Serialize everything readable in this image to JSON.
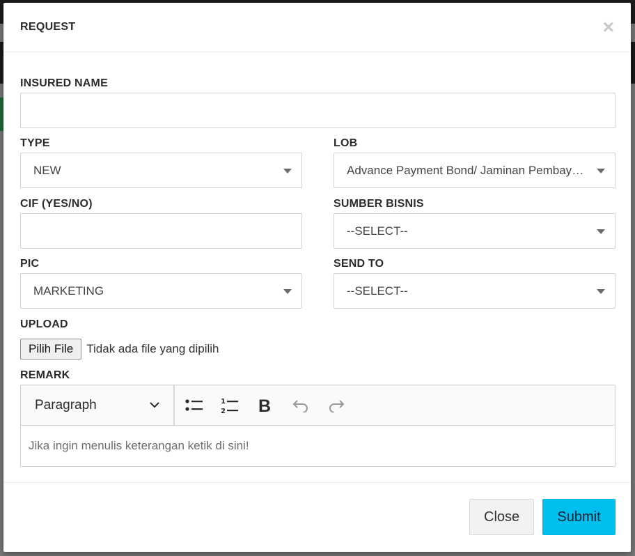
{
  "modal": {
    "title": "REQUEST",
    "close_icon": "close-icon"
  },
  "form": {
    "insured_name": {
      "label": "INSURED NAME",
      "value": ""
    },
    "type": {
      "label": "TYPE",
      "value": "NEW"
    },
    "lob": {
      "label": "LOB",
      "value": "Advance Payment Bond/ Jaminan Pembayaran Uang Muka"
    },
    "cif": {
      "label": "CIF (YES/NO)",
      "value": ""
    },
    "sumber_bisnis": {
      "label": "SUMBER BISNIS",
      "value": "--SELECT--"
    },
    "pic": {
      "label": "PIC",
      "value": "MARKETING"
    },
    "send_to": {
      "label": "SEND TO",
      "value": "--SELECT--"
    },
    "upload": {
      "label": "UPLOAD",
      "button": "Pilih File",
      "status": "Tidak ada file yang dipilih"
    },
    "remark": {
      "label": "REMARK",
      "block_format": "Paragraph",
      "placeholder": "Jika ingin menulis keterangan ketik di sini!",
      "toolbar_icons": [
        "bulleted-list-icon",
        "numbered-list-icon",
        "bold-icon",
        "undo-icon",
        "redo-icon"
      ]
    }
  },
  "footer": {
    "close_label": "Close",
    "submit_label": "Submit"
  },
  "colors": {
    "submit": "#00bfef",
    "close": "#f2f2f2"
  }
}
